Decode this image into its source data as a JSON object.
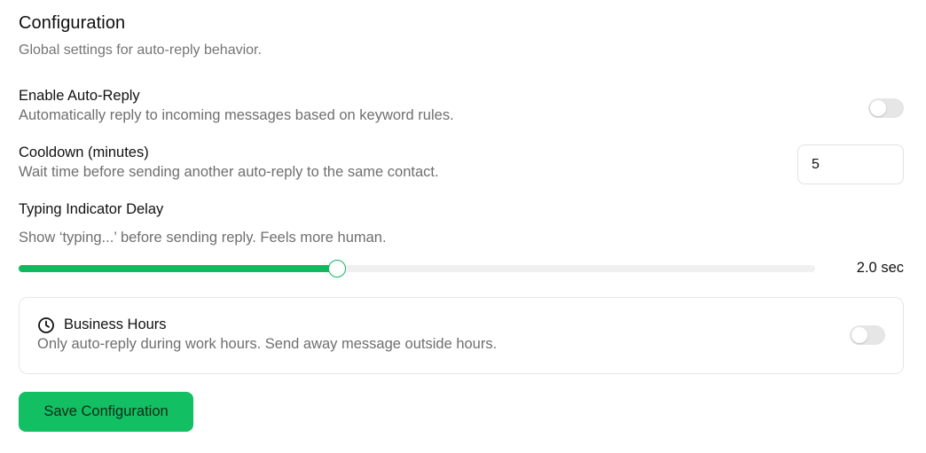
{
  "header": {
    "title": "Configuration",
    "subtitle": "Global settings for auto-reply behavior."
  },
  "auto_reply": {
    "label": "Enable Auto-Reply",
    "description": "Automatically reply to incoming messages based on keyword rules.",
    "enabled": false
  },
  "cooldown": {
    "label": "Cooldown (minutes)",
    "description": "Wait time before sending another auto-reply to the same contact.",
    "value": "5"
  },
  "typing_delay": {
    "label": "Typing Indicator Delay",
    "description": "Show ‘typing...’ before sending reply. Feels more human.",
    "value_label": "2.0 sec",
    "fill_fraction": 0.4
  },
  "business_hours": {
    "icon": "clock-icon",
    "label": "Business Hours",
    "description": "Only auto-reply during work hours. Send away message outside hours.",
    "enabled": false
  },
  "actions": {
    "save_label": "Save Configuration"
  },
  "colors": {
    "accent": "#12c063",
    "toggle_off": "#e6e6e6",
    "muted_text": "#6f6f6f"
  }
}
